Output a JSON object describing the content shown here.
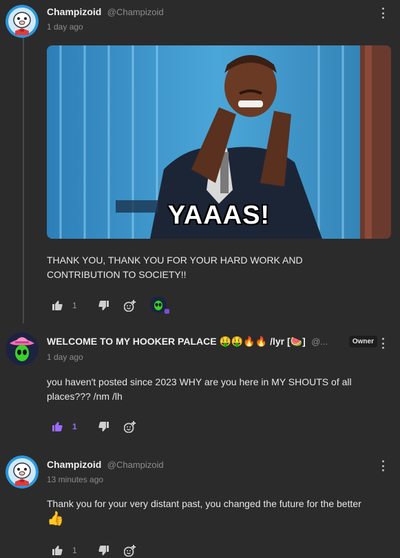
{
  "posts": [
    {
      "author": "Champizoid",
      "handle": "@Champizoid",
      "time": "1 day ago",
      "gif_caption": "YAAAS!",
      "text": "THANK YOU, THANK YOU FOR YOUR HARD WORK AND CONTRIBUTION TO SOCIETY!!",
      "likes": "1"
    },
    {
      "author": "WELCOME TO MY HOOKER PALACE 🤑🤑🔥🔥 /lyr [🍉]",
      "handle": "@...",
      "badge": "Owner",
      "time": "1 day ago",
      "text": "you haven't posted since 2023 WHY are you here in MY SHOUTS of all places??? /nm /lh",
      "likes": "1"
    },
    {
      "author": "Champizoid",
      "handle": "@Champizoid",
      "time": "13 minutes ago",
      "text": "Thank you for your very distant past, you changed the future for the better",
      "emoji": "👍",
      "likes": "1"
    }
  ],
  "icons": {
    "like": "thumbs-up-icon",
    "dislike": "thumbs-down-icon",
    "react": "add-reaction-icon",
    "menu": "more-vertical-icon"
  },
  "colors": {
    "background": "#2b2b2b",
    "liked": "#9b6bff",
    "muted": "#8d8d8d"
  }
}
